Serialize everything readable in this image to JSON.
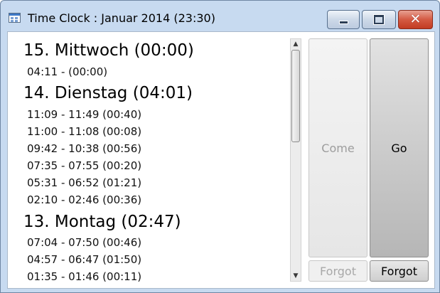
{
  "window": {
    "title": "Time Clock : Januar 2014 (23:30)",
    "controls": {
      "minimize": "minimize-icon",
      "maximize": "maximize-icon",
      "close": "close-icon"
    },
    "colors": {
      "frame": "#c7daf0",
      "close": "#c23b22"
    }
  },
  "log": {
    "days": [
      {
        "heading": "15. Mittwoch  (00:00)",
        "entries": [
          "04:11 -  (00:00)"
        ]
      },
      {
        "heading": "14. Dienstag  (04:01)",
        "entries": [
          "11:09 - 11:49 (00:40)",
          "11:00 - 11:08 (00:08)",
          "09:42 - 10:38 (00:56)",
          "07:35 - 07:55 (00:20)",
          "05:31 - 06:52 (01:21)",
          "02:10 - 02:46 (00:36)"
        ]
      },
      {
        "heading": "13. Montag  (02:47)",
        "entries": [
          "07:04 - 07:50 (00:46)",
          "04:57 - 06:47 (01:50)",
          "01:35 - 01:46 (00:11)"
        ]
      }
    ]
  },
  "actions": {
    "come": {
      "label": "Come",
      "enabled": false
    },
    "go": {
      "label": "Go",
      "enabled": true
    },
    "forgot_come": {
      "label": "Forgot",
      "enabled": false
    },
    "forgot_go": {
      "label": "Forgot",
      "enabled": true
    }
  }
}
